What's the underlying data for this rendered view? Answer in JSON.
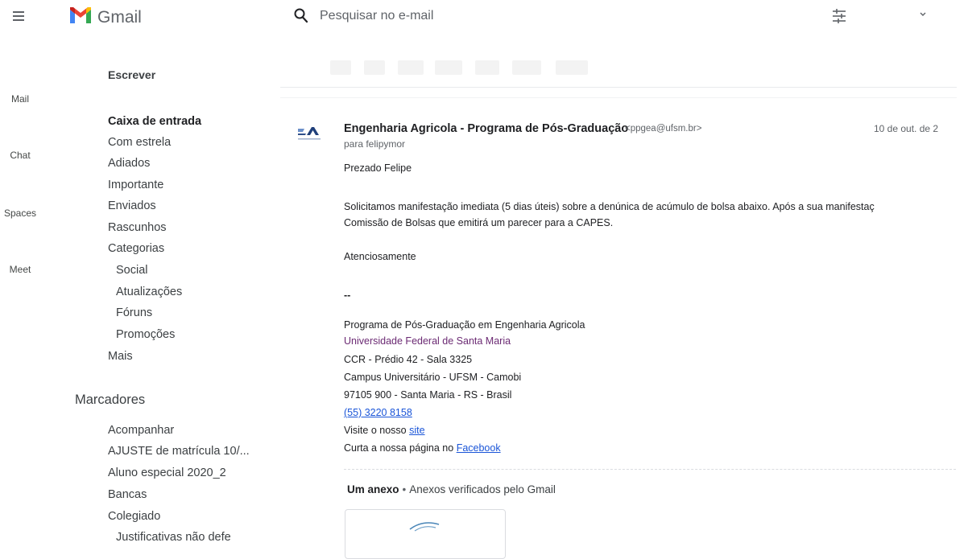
{
  "header": {
    "app_name": "Gmail",
    "search_placeholder": "Pesquisar no e-mail"
  },
  "rail": {
    "items": [
      {
        "label": "Mail"
      },
      {
        "label": "Chat"
      },
      {
        "label": "Spaces"
      },
      {
        "label": "Meet"
      }
    ]
  },
  "sidebar": {
    "compose_label": "Escrever",
    "items": [
      {
        "label": "Caixa de entrada",
        "active": true
      },
      {
        "label": "Com estrela"
      },
      {
        "label": "Adiados"
      },
      {
        "label": "Importante"
      },
      {
        "label": "Enviados"
      },
      {
        "label": "Rascunhos"
      },
      {
        "label": "Categorias"
      },
      {
        "label": "Social"
      },
      {
        "label": "Atualizações"
      },
      {
        "label": "Fóruns"
      },
      {
        "label": "Promoções"
      },
      {
        "label": "Mais"
      }
    ],
    "labels_heading": "Marcadores",
    "labels": [
      {
        "label": "Acompanhar"
      },
      {
        "label": "AJUSTE de matrícula 10/..."
      },
      {
        "label": "Aluno especial 2020_2"
      },
      {
        "label": "Bancas"
      },
      {
        "label": "Colegiado"
      },
      {
        "label": "Justificativas não defe"
      }
    ]
  },
  "email": {
    "sender_name": "Engenharia Agricola - Programa de Pós-Graduação",
    "sender_email": "<ppgea@ufsm.br>",
    "date": "10 de out. de 2",
    "recipient": "para felipymor",
    "greeting": "Prezado Felipe",
    "paragraph_line1": "Solicitamos manifestação imediata (5 dias úteis) sobre a denúnica de acúmulo de bolsa abaixo. Após a sua manifestaç",
    "paragraph_line2": "Comissão de Bolsas que emitirá um parecer para a CAPES.",
    "closing": "Atenciosamente",
    "signature_sep": "--",
    "signature": {
      "program": "Programa de Pós-Graduação em Engenharia Agricola",
      "university": "Universidade Federal de Santa Maria",
      "building": "CCR - Prédio 42 - Sala 3325",
      "campus": "Campus Universitário - UFSM - Camobi",
      "address": "97105 900 - Santa Maria - RS - Brasil",
      "phone": "(55) 3220 8158",
      "visit_prefix": "Visite o nosso ",
      "visit_link": "site",
      "facebook_prefix": "Curta a nossa página no ",
      "facebook_link": "Facebook"
    },
    "attachments": {
      "count_label": "Um anexo",
      "separator": "•",
      "verified_label": "Anexos verificados pelo Gmail"
    }
  },
  "colors": {
    "link": "#1a55d8",
    "university": "#6b2a73",
    "gmail_red": "#ea4335"
  }
}
